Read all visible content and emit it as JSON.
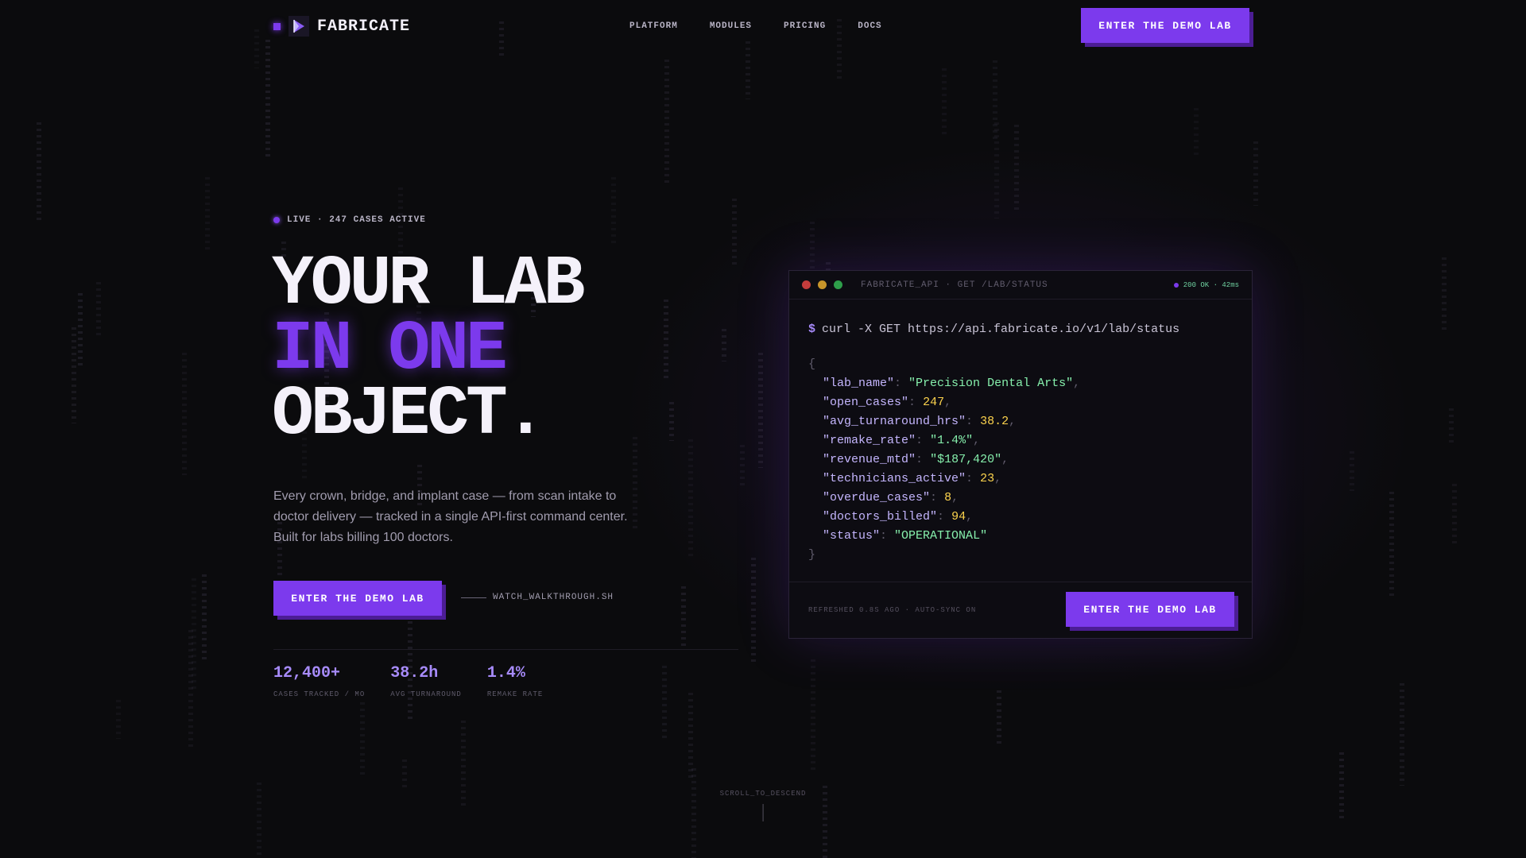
{
  "brand": {
    "name": "FABRICATE"
  },
  "nav": {
    "links": [
      "PLATFORM",
      "MODULES",
      "PRICING",
      "DOCS"
    ],
    "cta": "ENTER THE DEMO LAB"
  },
  "hero": {
    "live_text": "LIVE · 247 CASES ACTIVE",
    "headline": [
      "YOUR LAB",
      "IN ONE",
      "OBJECT."
    ],
    "description": "Every crown, bridge, and implant case — from scan intake to doctor delivery — tracked in a single API-first command center. Built for labs billing 100 doctors.",
    "cta": "ENTER THE DEMO LAB",
    "watch_link": "WATCH_WALKTHROUGH.SH",
    "stats": [
      {
        "value": "12,400+",
        "label": "CASES TRACKED / MO"
      },
      {
        "value": "38.2h",
        "label": "AVG TURNAROUND"
      },
      {
        "value": "1.4%",
        "label": "REMAKE RATE"
      }
    ]
  },
  "terminal": {
    "title": "FABRICATE_API · GET /LAB/STATUS",
    "status": "200 OK · 42ms",
    "prompt": "$",
    "command": "curl -X GET https://api.fabricate.io/v1/lab/status",
    "open_brace": "{",
    "close_brace": "}",
    "fields": [
      {
        "key": "\"lab_name\"",
        "value": "\"Precision Dental Arts\"",
        "type": "string"
      },
      {
        "key": "\"open_cases\"",
        "value": "247",
        "type": "number"
      },
      {
        "key": "\"avg_turnaround_hrs\"",
        "value": "38.2",
        "type": "number"
      },
      {
        "key": "\"remake_rate\"",
        "value": "\"1.4%\"",
        "type": "string"
      },
      {
        "key": "\"revenue_mtd\"",
        "value": "\"$187,420\"",
        "type": "string"
      },
      {
        "key": "\"technicians_active\"",
        "value": "23",
        "type": "number"
      },
      {
        "key": "\"overdue_cases\"",
        "value": "8",
        "type": "number"
      },
      {
        "key": "\"doctors_billed\"",
        "value": "94",
        "type": "number"
      },
      {
        "key": "\"status\"",
        "value": "\"OPERATIONAL\"",
        "type": "string"
      }
    ],
    "footer_text": "REFRESHED 0.8S AGO · AUTO-SYNC ON",
    "cta": "ENTER THE DEMO LAB"
  },
  "scroll": {
    "text": "SCROLL_TO_DESCEND"
  },
  "colors": {
    "accent": "#7c3aed",
    "accent_shadow": "#4c1d95",
    "background": "#0b0b0d"
  },
  "icons": {
    "brand_logo": "prism-logo-icon",
    "live": "live-dot-icon"
  }
}
